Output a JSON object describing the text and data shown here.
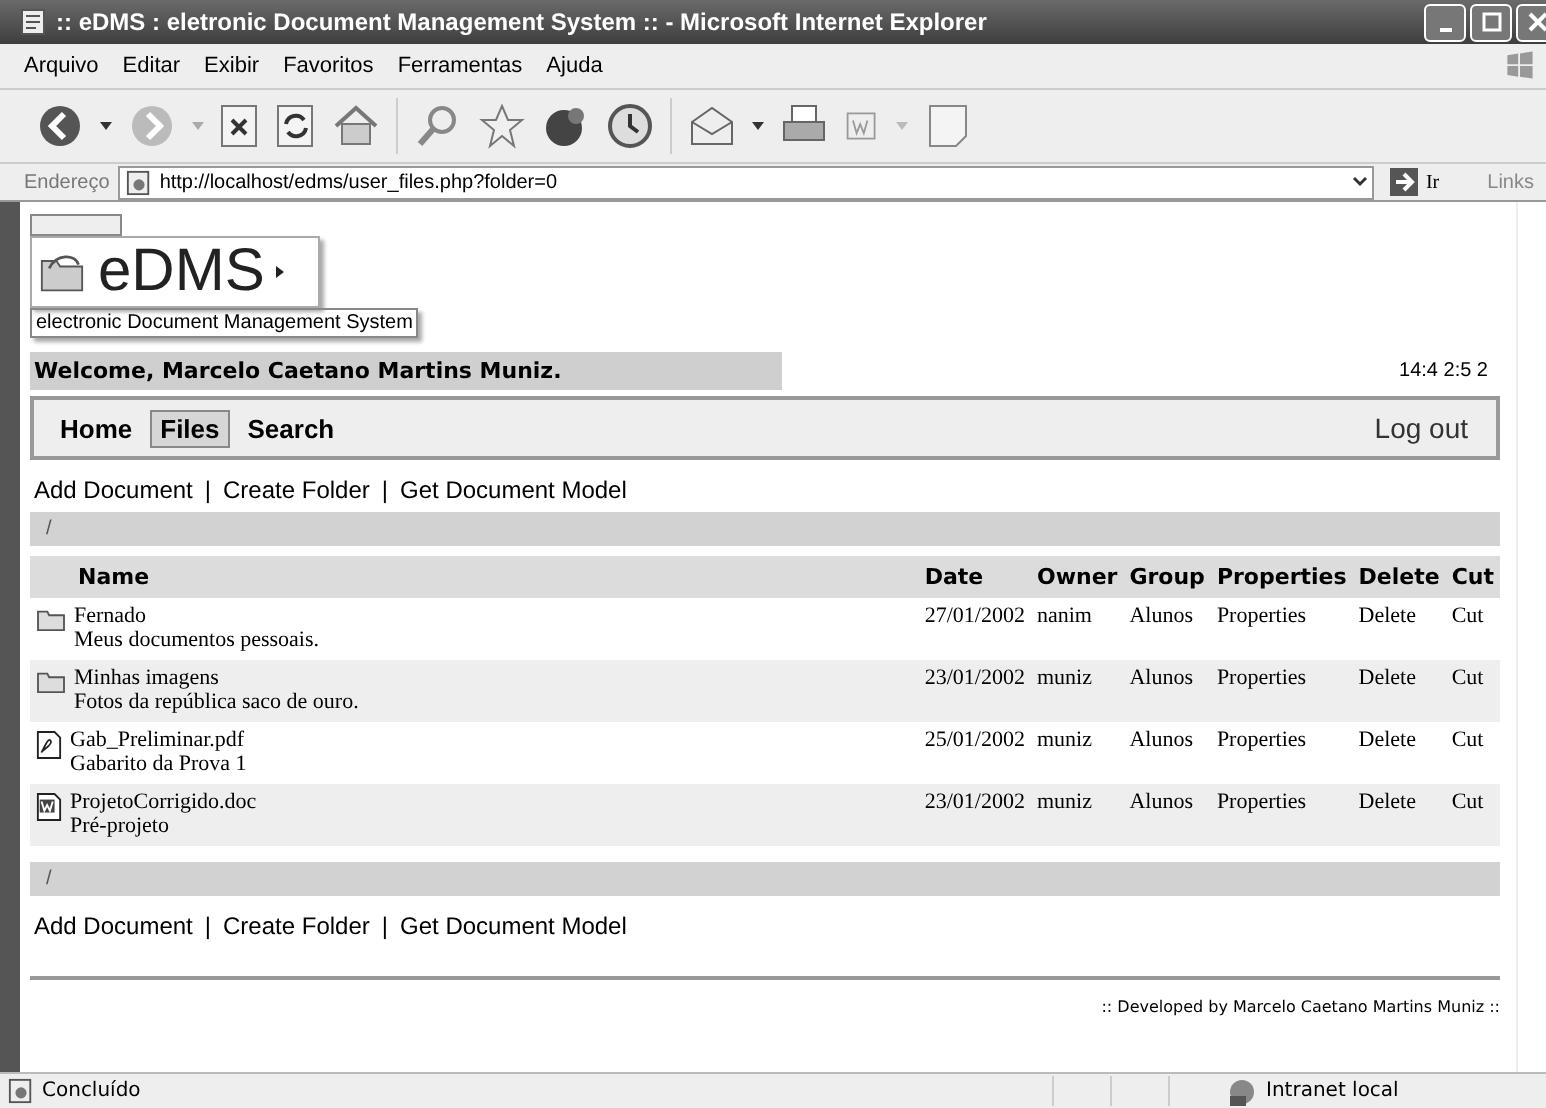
{
  "window": {
    "title": ":: eDMS : eletronic Document Management System :: - Microsoft Internet Explorer"
  },
  "menu": [
    "Arquivo",
    "Editar",
    "Exibir",
    "Favoritos",
    "Ferramentas",
    "Ajuda"
  ],
  "address": {
    "label": "Endereço",
    "value": "http://localhost/edms/user_files.php?folder=0",
    "go": "Ir",
    "links": "Links"
  },
  "page": {
    "logo": "eDMS",
    "tagline": "electronic Document Management System",
    "welcome": "Welcome, Marcelo Caetano Martins Muniz.",
    "time": "14:4 2:5 2",
    "nav": [
      {
        "label": "Home",
        "selected": false
      },
      {
        "label": "Files",
        "selected": true
      },
      {
        "label": "Search",
        "selected": false
      }
    ],
    "logout": "Log out",
    "actions": [
      "Add Document",
      "Create Folder",
      "Get Document Model"
    ],
    "separator": "|",
    "path": "/",
    "columns": [
      "Name",
      "Date",
      "Owner",
      "Group",
      "Properties",
      "Delete",
      "Cut"
    ],
    "rows": [
      {
        "kind": "folder",
        "name": "Fernado",
        "description": "Meus documentos pessoais.",
        "date": "27/01/2002",
        "owner": "nanim",
        "group": "Alunos",
        "properties": "Properties",
        "delete": "Delete",
        "cut": "Cut"
      },
      {
        "kind": "folder",
        "name": "Minhas imagens",
        "description": "Fotos da república saco de ouro.",
        "date": "23/01/2002",
        "owner": "muniz",
        "group": "Alunos",
        "properties": "Properties",
        "delete": "Delete",
        "cut": "Cut"
      },
      {
        "kind": "pdf",
        "name": "Gab_Preliminar.pdf",
        "description": "Gabarito da Prova 1",
        "date": "25/01/2002",
        "owner": "muniz",
        "group": "Alunos",
        "properties": "Properties",
        "delete": "Delete",
        "cut": "Cut"
      },
      {
        "kind": "doc",
        "name": "ProjetoCorrigido.doc",
        "description": "Pré-projeto",
        "date": "23/01/2002",
        "owner": "muniz",
        "group": "Alunos",
        "properties": "Properties",
        "delete": "Delete",
        "cut": "Cut"
      }
    ],
    "bottom_path": "/",
    "bottom_actions": [
      "Add Document",
      "Create Folder",
      "Get Document Model"
    ],
    "footer": ":: Developed by Marcelo Caetano Martins Muniz ::"
  },
  "status_bar": {
    "text": "Concluído",
    "zone": "Intranet local"
  }
}
